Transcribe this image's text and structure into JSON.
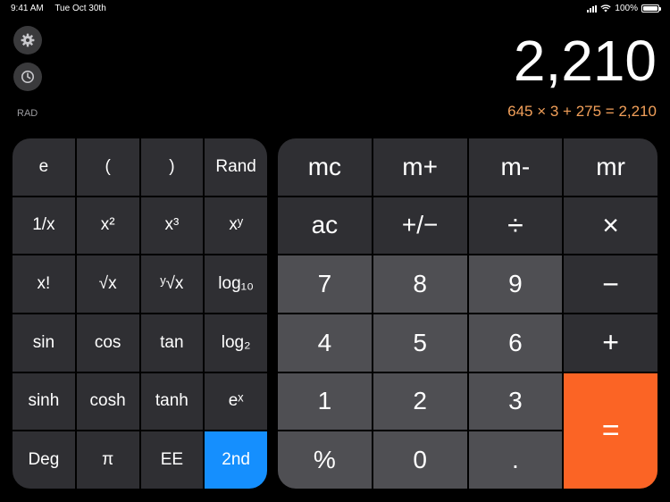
{
  "status_bar": {
    "time": "9:41 AM",
    "date": "Tue Oct 30th",
    "battery": "100%"
  },
  "mode_label": "RAD",
  "display": {
    "value": "2,210",
    "expression": "645 × 3 + 275 = 2,210"
  },
  "icons": {
    "settings": "gear-icon",
    "history": "clock-icon"
  },
  "scientific_keys": [
    [
      "e",
      "(",
      ")",
      "Rand"
    ],
    [
      "1/x",
      "x²",
      "x³",
      "xʸ"
    ],
    [
      "x!",
      "√x",
      "ʸ√x",
      "log₁₀"
    ],
    [
      "sin",
      "cos",
      "tan",
      "log₂"
    ],
    [
      "sinh",
      "cosh",
      "tanh",
      "eˣ"
    ],
    [
      "Deg",
      "π",
      "EE",
      "2nd"
    ]
  ],
  "main_keys": {
    "memory": [
      "mc",
      "m+",
      "m-",
      "mr"
    ],
    "row2": [
      "ac",
      "+/−",
      "÷",
      "×"
    ],
    "row3": [
      "7",
      "8",
      "9",
      "−"
    ],
    "row4": [
      "4",
      "5",
      "6",
      "+"
    ],
    "row5": [
      "1",
      "2",
      "3"
    ],
    "row6": [
      "%",
      "0",
      "."
    ],
    "equals": "="
  },
  "colors": {
    "accent_orange": "#fb6425",
    "active_blue": "#158ffe",
    "expression_orange": "#f2a05a"
  }
}
